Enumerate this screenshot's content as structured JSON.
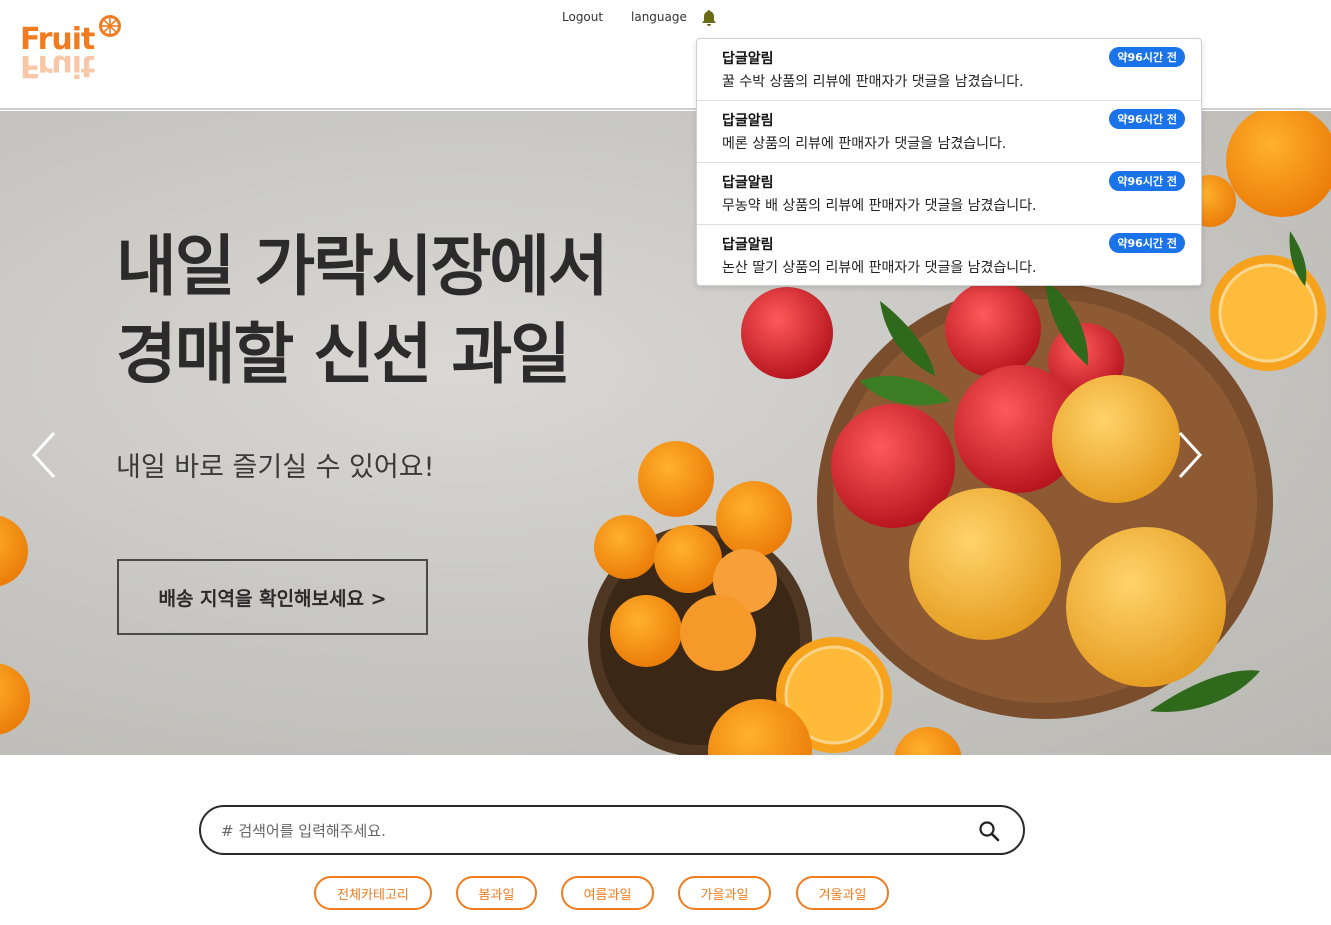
{
  "header": {
    "logo_text": "Fruit",
    "nav": {
      "logout": "Logout",
      "language": "language"
    }
  },
  "notifications": [
    {
      "title": "답글알림",
      "body": "꿀 수박 상품의 리뷰에 판매자가 댓글을 남겼습니다.",
      "time": "약96시간 전"
    },
    {
      "title": "답글알림",
      "body": "메론 상품의 리뷰에 판매자가 댓글을 남겼습니다.",
      "time": "약96시간 전"
    },
    {
      "title": "답글알림",
      "body": "무농약 배 상품의 리뷰에 판매자가 댓글을 남겼습니다.",
      "time": "약96시간 전"
    },
    {
      "title": "답글알림",
      "body": "논산 딸기 상품의 리뷰에 판매자가 댓글을 남겼습니다.",
      "time": "약96시간 전"
    }
  ],
  "hero": {
    "title_line1": "내일 가락시장에서",
    "title_line2": "경매할 신선 과일",
    "subtitle": "내일 바로 즐기실 수 있어요!",
    "cta": "배송 지역을 확인해보세요  >"
  },
  "search": {
    "placeholder": "# 검색어를 입력해주세요."
  },
  "categories": [
    "전체카테고리",
    "봄과일",
    "여름과일",
    "가을과일",
    "겨울과일"
  ],
  "colors": {
    "brand_orange": "#f07c1f",
    "badge_blue": "#1a73e8"
  },
  "icons": {
    "bell": "bell-icon",
    "search": "search-icon",
    "prev": "chevron-left-icon",
    "next": "chevron-right-icon"
  }
}
